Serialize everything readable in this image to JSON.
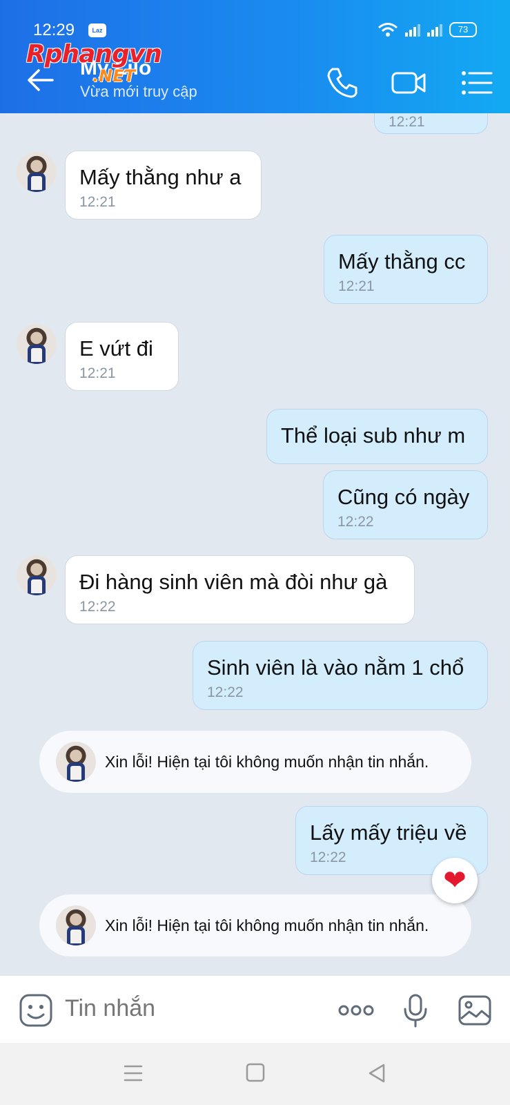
{
  "status_bar": {
    "time": "12:29",
    "app_badge": "Laz",
    "battery": "73"
  },
  "header": {
    "contact_name": "My Lilo",
    "contact_status": "Vừa mới truy cập",
    "watermark_main": "Rphangvn",
    "watermark_sub": ".NET",
    "icons": [
      "back-arrow-icon",
      "phone-icon",
      "video-call-icon",
      "menu-list-icon"
    ]
  },
  "messages": [
    {
      "direction": "out",
      "text": "",
      "time": "12:21"
    },
    {
      "direction": "in",
      "text": "Mấy thằng như a",
      "time": "12:21"
    },
    {
      "direction": "out",
      "text": "Mấy thằng cc",
      "time": "12:21"
    },
    {
      "direction": "in",
      "text": "E vứt đi",
      "time": "12:21"
    },
    {
      "direction": "out",
      "text": "Thể loại sub như m",
      "time": ""
    },
    {
      "direction": "out",
      "text": "Cũng có ngày",
      "time": "12:22"
    },
    {
      "direction": "in",
      "text": "Đi hàng sinh viên mà đòi như gà",
      "time": "12:22"
    },
    {
      "direction": "out",
      "text": "Sinh viên là vào nằm 1 chổ",
      "time": "12:22"
    },
    {
      "direction": "notice",
      "text": "Xin lỗi! Hiện tại tôi không muốn nhận tin nhắn.",
      "time": ""
    },
    {
      "direction": "out",
      "text": "Lấy mấy triệu về",
      "time": "12:22"
    },
    {
      "direction": "notice",
      "text": "Xin lỗi! Hiện tại tôi không muốn nhận tin nhắn.",
      "time": ""
    }
  ],
  "reaction": {
    "icon": "heart-icon",
    "color": "#e3192d"
  },
  "composer": {
    "placeholder": "Tin nhắn",
    "icons": [
      "emoji-icon",
      "more-dots-icon",
      "microphone-icon",
      "image-icon"
    ]
  },
  "colors": {
    "header_start": "#1e6fe6",
    "header_end": "#13a9f2",
    "chat_bg": "#e2e8f0",
    "bubble_in": "#ffffff",
    "bubble_out": "#d4edfd"
  }
}
